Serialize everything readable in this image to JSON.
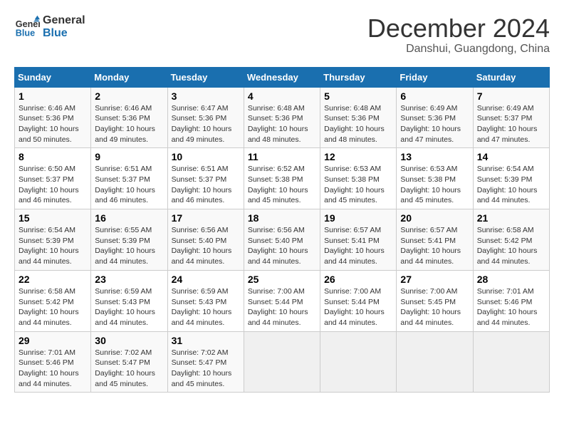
{
  "logo": {
    "line1": "General",
    "line2": "Blue"
  },
  "title": "December 2024",
  "subtitle": "Danshui, Guangdong, China",
  "days_of_week": [
    "Sunday",
    "Monday",
    "Tuesday",
    "Wednesday",
    "Thursday",
    "Friday",
    "Saturday"
  ],
  "weeks": [
    [
      {
        "day": "1",
        "info": "Sunrise: 6:46 AM\nSunset: 5:36 PM\nDaylight: 10 hours\nand 50 minutes."
      },
      {
        "day": "2",
        "info": "Sunrise: 6:46 AM\nSunset: 5:36 PM\nDaylight: 10 hours\nand 49 minutes."
      },
      {
        "day": "3",
        "info": "Sunrise: 6:47 AM\nSunset: 5:36 PM\nDaylight: 10 hours\nand 49 minutes."
      },
      {
        "day": "4",
        "info": "Sunrise: 6:48 AM\nSunset: 5:36 PM\nDaylight: 10 hours\nand 48 minutes."
      },
      {
        "day": "5",
        "info": "Sunrise: 6:48 AM\nSunset: 5:36 PM\nDaylight: 10 hours\nand 48 minutes."
      },
      {
        "day": "6",
        "info": "Sunrise: 6:49 AM\nSunset: 5:36 PM\nDaylight: 10 hours\nand 47 minutes."
      },
      {
        "day": "7",
        "info": "Sunrise: 6:49 AM\nSunset: 5:37 PM\nDaylight: 10 hours\nand 47 minutes."
      }
    ],
    [
      {
        "day": "8",
        "info": "Sunrise: 6:50 AM\nSunset: 5:37 PM\nDaylight: 10 hours\nand 46 minutes."
      },
      {
        "day": "9",
        "info": "Sunrise: 6:51 AM\nSunset: 5:37 PM\nDaylight: 10 hours\nand 46 minutes."
      },
      {
        "day": "10",
        "info": "Sunrise: 6:51 AM\nSunset: 5:37 PM\nDaylight: 10 hours\nand 46 minutes."
      },
      {
        "day": "11",
        "info": "Sunrise: 6:52 AM\nSunset: 5:38 PM\nDaylight: 10 hours\nand 45 minutes."
      },
      {
        "day": "12",
        "info": "Sunrise: 6:53 AM\nSunset: 5:38 PM\nDaylight: 10 hours\nand 45 minutes."
      },
      {
        "day": "13",
        "info": "Sunrise: 6:53 AM\nSunset: 5:38 PM\nDaylight: 10 hours\nand 45 minutes."
      },
      {
        "day": "14",
        "info": "Sunrise: 6:54 AM\nSunset: 5:39 PM\nDaylight: 10 hours\nand 44 minutes."
      }
    ],
    [
      {
        "day": "15",
        "info": "Sunrise: 6:54 AM\nSunset: 5:39 PM\nDaylight: 10 hours\nand 44 minutes."
      },
      {
        "day": "16",
        "info": "Sunrise: 6:55 AM\nSunset: 5:39 PM\nDaylight: 10 hours\nand 44 minutes."
      },
      {
        "day": "17",
        "info": "Sunrise: 6:56 AM\nSunset: 5:40 PM\nDaylight: 10 hours\nand 44 minutes."
      },
      {
        "day": "18",
        "info": "Sunrise: 6:56 AM\nSunset: 5:40 PM\nDaylight: 10 hours\nand 44 minutes."
      },
      {
        "day": "19",
        "info": "Sunrise: 6:57 AM\nSunset: 5:41 PM\nDaylight: 10 hours\nand 44 minutes."
      },
      {
        "day": "20",
        "info": "Sunrise: 6:57 AM\nSunset: 5:41 PM\nDaylight: 10 hours\nand 44 minutes."
      },
      {
        "day": "21",
        "info": "Sunrise: 6:58 AM\nSunset: 5:42 PM\nDaylight: 10 hours\nand 44 minutes."
      }
    ],
    [
      {
        "day": "22",
        "info": "Sunrise: 6:58 AM\nSunset: 5:42 PM\nDaylight: 10 hours\nand 44 minutes."
      },
      {
        "day": "23",
        "info": "Sunrise: 6:59 AM\nSunset: 5:43 PM\nDaylight: 10 hours\nand 44 minutes."
      },
      {
        "day": "24",
        "info": "Sunrise: 6:59 AM\nSunset: 5:43 PM\nDaylight: 10 hours\nand 44 minutes."
      },
      {
        "day": "25",
        "info": "Sunrise: 7:00 AM\nSunset: 5:44 PM\nDaylight: 10 hours\nand 44 minutes."
      },
      {
        "day": "26",
        "info": "Sunrise: 7:00 AM\nSunset: 5:44 PM\nDaylight: 10 hours\nand 44 minutes."
      },
      {
        "day": "27",
        "info": "Sunrise: 7:00 AM\nSunset: 5:45 PM\nDaylight: 10 hours\nand 44 minutes."
      },
      {
        "day": "28",
        "info": "Sunrise: 7:01 AM\nSunset: 5:46 PM\nDaylight: 10 hours\nand 44 minutes."
      }
    ],
    [
      {
        "day": "29",
        "info": "Sunrise: 7:01 AM\nSunset: 5:46 PM\nDaylight: 10 hours\nand 44 minutes."
      },
      {
        "day": "30",
        "info": "Sunrise: 7:02 AM\nSunset: 5:47 PM\nDaylight: 10 hours\nand 45 minutes."
      },
      {
        "day": "31",
        "info": "Sunrise: 7:02 AM\nSunset: 5:47 PM\nDaylight: 10 hours\nand 45 minutes."
      },
      {
        "day": "",
        "info": ""
      },
      {
        "day": "",
        "info": ""
      },
      {
        "day": "",
        "info": ""
      },
      {
        "day": "",
        "info": ""
      }
    ]
  ]
}
